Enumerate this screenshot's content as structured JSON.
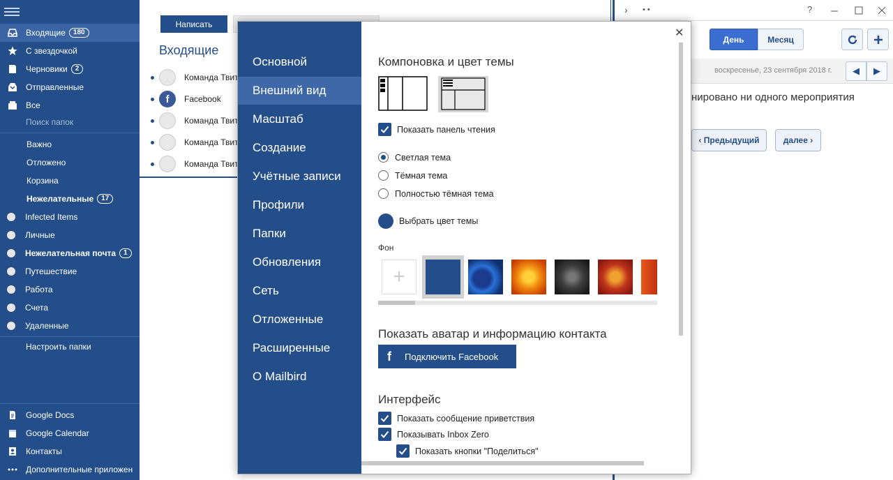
{
  "sidebar": {
    "folders": [
      {
        "label": "Входящие",
        "badge": "180",
        "icon": "inbox-icon"
      },
      {
        "label": "С звездочкой",
        "icon": "star-icon"
      },
      {
        "label": "Черновики",
        "badge": "2",
        "icon": "draft-icon"
      },
      {
        "label": "Отправленные",
        "icon": "sent-icon"
      },
      {
        "label": "Все",
        "icon": "all-mail-icon"
      }
    ],
    "search_placeholder": "Поиск папок",
    "labels": [
      {
        "label": "Важно"
      },
      {
        "label": "Отложено"
      },
      {
        "label": "Корзина"
      },
      {
        "label": "Нежелательные",
        "badge": "17"
      }
    ],
    "custom": [
      {
        "label": "Infected Items"
      },
      {
        "label": "Личные"
      },
      {
        "label": "Нежелательная почта",
        "badge": "1"
      },
      {
        "label": "Путешествие"
      },
      {
        "label": "Работа"
      },
      {
        "label": "Счета"
      },
      {
        "label": "Удаленные"
      }
    ],
    "configure": "Настроить папки",
    "apps": [
      {
        "label": "Google Docs",
        "icon": "docs-icon"
      },
      {
        "label": "Google Calendar",
        "icon": "calendar-icon"
      },
      {
        "label": "Контакты",
        "icon": "contacts-icon"
      },
      {
        "label": "Дополнительные приложен",
        "icon": "more-apps-icon"
      }
    ]
  },
  "mail": {
    "write_label": "Написать",
    "title": "Входящие",
    "rows": [
      {
        "sender": "Команда Твит"
      },
      {
        "sender": "Facebook"
      },
      {
        "sender": "Команда Твит"
      },
      {
        "sender": "Команда Твит"
      },
      {
        "sender": "Команда Твит"
      }
    ]
  },
  "calendar": {
    "window_help": "?",
    "day_label": "День",
    "month_label": "Месяц",
    "date": "воскресенье, 23 сентября 2018 г.",
    "empty_text": "нировано ни одного мероприятия",
    "prev_label": "‹ Предыдущий",
    "next_label": "далее ›"
  },
  "settings": {
    "nav": [
      "Основной",
      "Внешний вид",
      "Масштаб",
      "Создание",
      "Учётные записи",
      "Профили",
      "Папки",
      "Обновления",
      "Сеть",
      "Отложенные",
      "Расширенные",
      "О Mailbird"
    ],
    "active_nav": 1,
    "layout_title": "Компоновка и цвет темы",
    "show_reading_pane": "Показать панель чтения",
    "themes": [
      "Светлая тема",
      "Тёмная тема",
      "Полностью тёмная тема"
    ],
    "selected_theme": 0,
    "pick_color": "Выбрать цвет темы",
    "theme_color": "#244e8a",
    "background_label": "Фон",
    "add_symbol": "+",
    "avatar_title": "Показать аватар и информацию контакта",
    "fb_button": "Подключить Facebook",
    "interface_title": "Интерфейс",
    "interface_options": [
      "Показать сообщение приветствия",
      "Показывать Inbox Zero",
      "Показать кнопки \"Поделиться\""
    ]
  },
  "colors": {
    "primary": "#244e8a",
    "accent": "#3a6ed0"
  }
}
